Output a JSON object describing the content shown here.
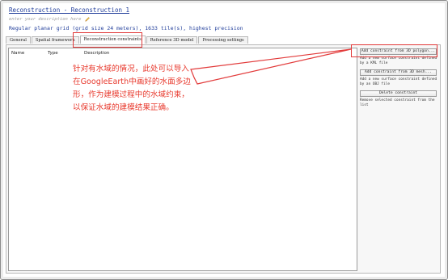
{
  "header": {
    "title": "Reconstruction - Reconstruction_1",
    "description_placeholder": "enter your description here",
    "summary": "Regular planar grid (grid size 24 meters), 1633 tile(s), highest precision"
  },
  "tabs": [
    {
      "label": "General"
    },
    {
      "label": "Spatial framework"
    },
    {
      "label": "Reconstruction constraints"
    },
    {
      "label": "Reference 3D model"
    },
    {
      "label": "Processing settings"
    }
  ],
  "active_tab": "Reconstruction constraints",
  "constraints_table": {
    "columns": [
      "Name",
      "Type",
      "Description"
    ],
    "rows": []
  },
  "side_panel": {
    "add_kml": {
      "label": "Add constraint from 3D polygon...",
      "description": "Add a new surface constraint defined by a KML file"
    },
    "add_obj": {
      "label": "Add constraint from 3D mesh...",
      "description": "Add a new surface constraint defined by an OBJ file"
    },
    "delete": {
      "label": "Delete constraint",
      "description": "Remove selected constraint from the list"
    }
  },
  "annotation": {
    "lines": [
      "针对有水域的情况，此处可以导入",
      "在GoogleEarth中画好的水面多边",
      "形，作为建模过程中的水域约束，",
      "以保证水域的建模结果正确。"
    ]
  },
  "colors": {
    "highlight": "#e23a3a",
    "annotation_text": "#e83a2e",
    "title_link": "#1f3c9a"
  }
}
